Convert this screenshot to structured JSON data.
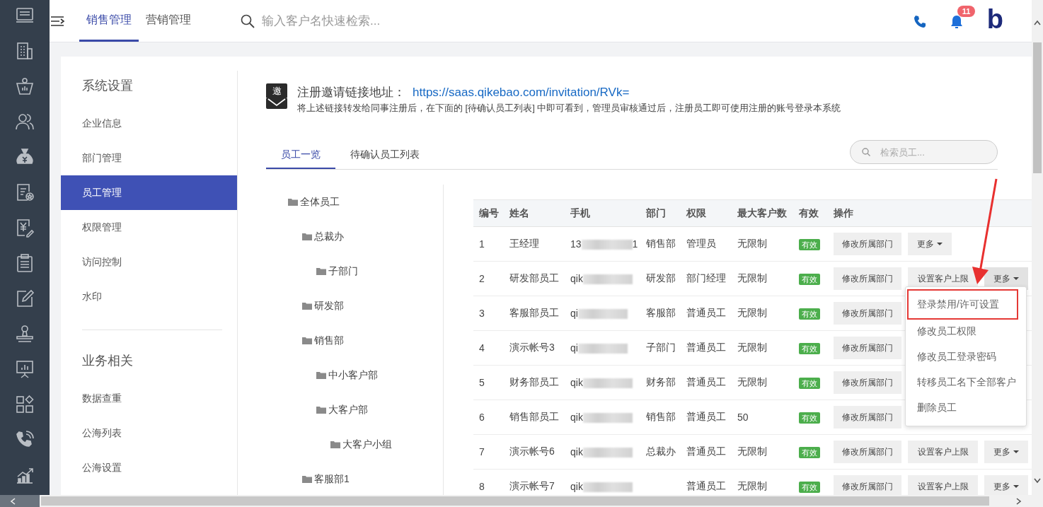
{
  "top_tabs": [
    {
      "label": "销售管理",
      "selected": true
    },
    {
      "label": "营销管理",
      "selected": false
    }
  ],
  "search": {
    "placeholder": "输入客户名快速检索..."
  },
  "notifications": {
    "count": "11"
  },
  "logo": "b",
  "settings_nav": [
    {
      "title": "系统设置",
      "items": [
        {
          "label": "企业信息",
          "selected": false
        },
        {
          "label": "部门管理",
          "selected": false
        },
        {
          "label": "员工管理",
          "selected": true
        },
        {
          "label": "权限管理",
          "selected": false
        },
        {
          "label": "访问控制",
          "selected": false
        },
        {
          "label": "水印",
          "selected": false
        }
      ]
    },
    {
      "title": "业务相关",
      "items": [
        {
          "label": "数据查重",
          "selected": false
        },
        {
          "label": "公海列表",
          "selected": false
        },
        {
          "label": "公海设置",
          "selected": false
        }
      ]
    }
  ],
  "invitation": {
    "icon_text": "邀",
    "label": "注册邀请链接地址：",
    "link": "https://saas.qikebao.com/invitation/RVk=",
    "hint": "将上述链接转发给同事注册后，在下面的 [待确认员工列表] 中即可看到，管理员审核通过后，注册员工即可使用注册的账号登录本系统"
  },
  "staff_tabs": [
    {
      "label": "员工一览",
      "selected": true
    },
    {
      "label": "待确认员工列表",
      "selected": false
    }
  ],
  "staff_search": {
    "placeholder": "检索员工..."
  },
  "department_tree": [
    {
      "label": "全体员工",
      "children": [
        {
          "label": "总裁办",
          "children": [
            {
              "label": "子部门"
            }
          ]
        },
        {
          "label": "研发部"
        },
        {
          "label": "销售部",
          "children": [
            {
              "label": "中小客户部"
            },
            {
              "label": "大客户部",
              "children": [
                {
                  "label": "大客户小组"
                }
              ]
            }
          ]
        },
        {
          "label": "客服部1"
        }
      ]
    }
  ],
  "table": {
    "columns": [
      "编号",
      "姓名",
      "手机",
      "部门",
      "权限",
      "最大客户数",
      "有效",
      "操作"
    ],
    "rows": [
      {
        "no": "1",
        "name": "王经理",
        "phone_prefix": "13",
        "phone_suffix": "1",
        "department": "销售部",
        "role": "管理员",
        "max_customers": "无限制",
        "status": "有效",
        "actions": [
          {
            "label": "修改所属部门",
            "kind": "button"
          },
          {
            "label": "更多",
            "kind": "dropdown",
            "expanded": false
          }
        ]
      },
      {
        "no": "2",
        "name": "研发部员工",
        "phone_prefix": "qik",
        "department": "研发部",
        "role": "部门经理",
        "max_customers": "无限制",
        "status": "有效",
        "actions": [
          {
            "label": "修改所属部门",
            "kind": "button"
          },
          {
            "label": "设置客户上限",
            "kind": "button"
          },
          {
            "label": "更多",
            "kind": "dropdown",
            "expanded": true
          }
        ]
      },
      {
        "no": "3",
        "name": "客服部员工",
        "phone_prefix": "qi",
        "department": "客服部",
        "role": "普通员工",
        "max_customers": "无限制",
        "status": "有效",
        "actions": [
          {
            "label": "修改所属部门",
            "kind": "button"
          }
        ]
      },
      {
        "no": "4",
        "name": "演示帐号3",
        "phone_prefix": "qi",
        "department": "子部门",
        "role": "普通员工",
        "max_customers": "无限制",
        "status": "有效",
        "actions": [
          {
            "label": "修改所属部门",
            "kind": "button"
          }
        ]
      },
      {
        "no": "5",
        "name": "财务部员工",
        "phone_prefix": "qik",
        "department": "财务部",
        "role": "普通员工",
        "max_customers": "无限制",
        "status": "有效",
        "actions": [
          {
            "label": "修改所属部门",
            "kind": "button"
          }
        ]
      },
      {
        "no": "6",
        "name": "销售部员工",
        "phone_prefix": "qik",
        "department": "销售部",
        "role": "普通员工",
        "max_customers": "50",
        "status": "有效",
        "actions": [
          {
            "label": "修改所属部门",
            "kind": "button"
          }
        ]
      },
      {
        "no": "7",
        "name": "演示帐号6",
        "phone_prefix": "qik",
        "department": "总裁办",
        "role": "普通员工",
        "max_customers": "无限制",
        "status": "有效",
        "actions": [
          {
            "label": "修改所属部门",
            "kind": "button"
          },
          {
            "label": "设置客户上限",
            "kind": "button"
          },
          {
            "label": "更多",
            "kind": "dropdown",
            "expanded": false
          }
        ]
      },
      {
        "no": "8",
        "name": "演示帐号7",
        "phone_prefix": "qik",
        "role": "普通员工",
        "max_customers": "无限制",
        "status": "有效",
        "actions": [
          {
            "label": "修改所属部门",
            "kind": "button"
          },
          {
            "label": "设置客户上限",
            "kind": "button"
          },
          {
            "label": "更多",
            "kind": "dropdown",
            "expanded": false
          }
        ]
      }
    ]
  },
  "more_menu": {
    "items": [
      {
        "label": "登录禁用/许可设置",
        "annotated": true
      },
      {
        "label": "修改员工权限",
        "annotated": false
      },
      {
        "label": "修改员工登录密码",
        "annotated": false
      },
      {
        "label": "转移员工名下全部客户",
        "annotated": false
      },
      {
        "label": "删除员工",
        "annotated": false
      }
    ]
  }
}
